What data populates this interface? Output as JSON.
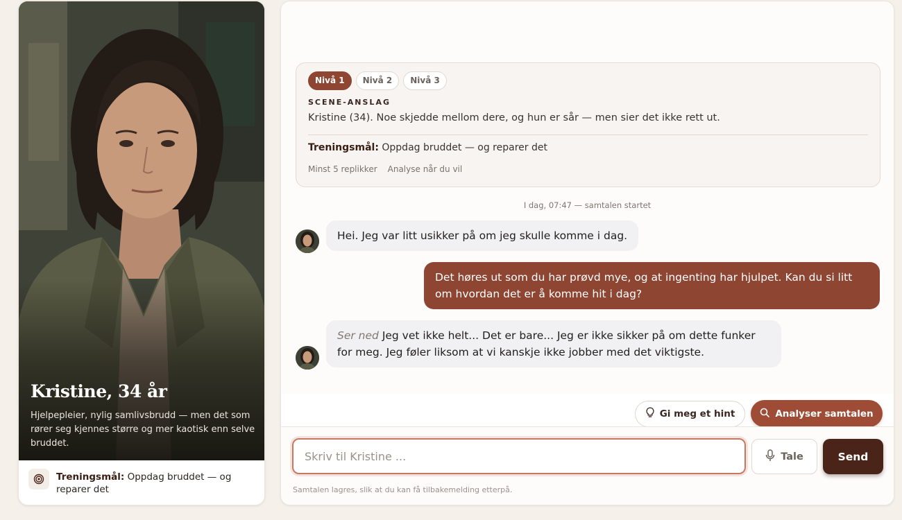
{
  "persona": {
    "name": "Kristine, 34 år",
    "description": "Hjelpepleier, nylig samlivsbrudd — men det som rører seg kjennes større og mer kaotisk enn selve bruddet.",
    "goal_label": "Treningsmål:",
    "goal_text": "Oppdag bruddet — og reparer det",
    "goal_icon": "target-icon"
  },
  "scene": {
    "levels": [
      {
        "label": "Nivå 1",
        "active": true
      },
      {
        "label": "Nivå 2",
        "active": false
      },
      {
        "label": "Nivå 3",
        "active": false
      }
    ],
    "section_label": "SCENE-ANSLAG",
    "text": "Kristine (34). Noe skjedde mellom dere, og hun er sår — men sier det ikke rett ut.",
    "goal_label": "Treningsmål:",
    "goal_text": "Oppdag bruddet — og reparer det",
    "meta_min_replies": "Minst 5 replikker",
    "meta_analysis": "Analyse når du vil"
  },
  "conversation": {
    "timestamp": "I dag, 07:47 — samtalen startet",
    "messages": [
      {
        "from": "persona",
        "text": "Hei. Jeg var litt usikker på om jeg skulle komme i dag."
      },
      {
        "from": "user",
        "text": "Det høres ut som du har prøvd mye, og at ingenting har hjulpet. Kan du si litt om hvordan det er å komme hit i dag?"
      },
      {
        "from": "persona",
        "action": "Ser ned",
        "text": "Jeg vet ikke helt... Det er bare... Jeg er ikke sikker på om dette funker for meg. Jeg føler liksom at vi kanskje ikke jobber med det viktigste."
      }
    ]
  },
  "actions": {
    "hint_label": "Gi meg et hint",
    "hint_icon": "lightbulb-icon",
    "analyse_label": "Analyser samtalen",
    "analyse_icon": "search-icon"
  },
  "composer": {
    "placeholder": "Skriv til Kristine ...",
    "voice_label": "Tale",
    "voice_icon": "microphone-icon",
    "send_label": "Send",
    "footnote": "Samtalen lagres, slik at du kan få tilbakemelding etterpå."
  },
  "colors": {
    "accent": "#8e4532",
    "accent_dark": "#4a2418",
    "background": "#f5f0ea"
  }
}
